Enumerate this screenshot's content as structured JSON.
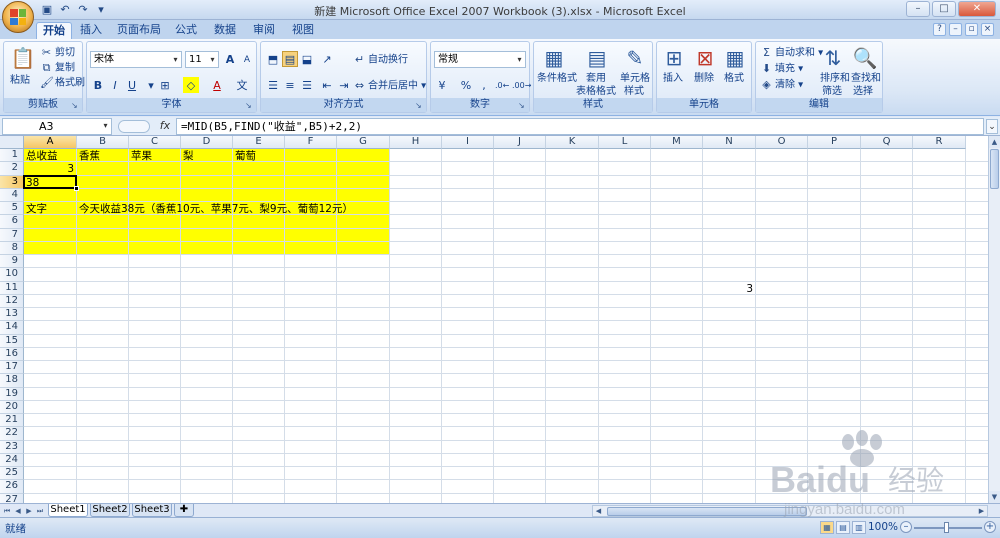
{
  "window": {
    "title": "新建 Microsoft Office Excel 2007 Workbook (3).xlsx - Microsoft Excel",
    "controls": [
      "–",
      "□",
      "✕"
    ]
  },
  "quick_access": [
    "save-icon",
    "undo-icon",
    "redo-icon",
    "customize-icon"
  ],
  "tabs": [
    {
      "label": "开始",
      "active": true
    },
    {
      "label": "插入"
    },
    {
      "label": "页面布局"
    },
    {
      "label": "公式"
    },
    {
      "label": "数据"
    },
    {
      "label": "审阅"
    },
    {
      "label": "视图"
    }
  ],
  "ribbon": {
    "clipboard": {
      "label": "剪贴板",
      "paste": "粘贴",
      "cut": "剪切",
      "copy": "复制",
      "format_painter": "格式刷"
    },
    "font": {
      "label": "字体",
      "font_name": "宋体",
      "font_size": "11",
      "bold": "B",
      "italic": "I",
      "underline": "U",
      "grow": "A",
      "shrink": "A"
    },
    "alignment": {
      "label": "对齐方式",
      "wrap": "自动换行",
      "merge": "合并后居中"
    },
    "number": {
      "label": "数字",
      "format": "常规",
      "percent": "%",
      "comma": ","
    },
    "styles": {
      "label": "样式",
      "conditional": "条件格式",
      "table_format_1": "套用",
      "table_format_2": "表格格式",
      "cell_style_1": "单元格",
      "cell_style_2": "样式"
    },
    "cells": {
      "label": "单元格",
      "insert": "插入",
      "delete": "删除",
      "format": "格式"
    },
    "editing": {
      "label": "编辑",
      "autosum": "自动求和",
      "fill": "填充",
      "clear": "清除",
      "sort_1": "排序和",
      "sort_2": "筛选",
      "find_1": "查找和",
      "find_2": "选择"
    }
  },
  "formula_bar": {
    "name_box": "A3",
    "fx": "fx",
    "formula": "=MID(B5,FIND(\"收益\",B5)+2,2)"
  },
  "columns": [
    "A",
    "B",
    "C",
    "D",
    "E",
    "F",
    "G",
    "H",
    "I",
    "J",
    "K",
    "L",
    "M",
    "N",
    "O",
    "P",
    "Q",
    "R"
  ],
  "rows": [
    "1",
    "2",
    "3",
    "4",
    "5",
    "6",
    "7",
    "8",
    "9",
    "10",
    "11",
    "12",
    "13",
    "14",
    "15",
    "16",
    "17",
    "18",
    "19",
    "20",
    "21",
    "22",
    "23",
    "24",
    "25",
    "26",
    "27"
  ],
  "cells": {
    "A1": "总收益",
    "B1": "香蕉",
    "C1": "苹果",
    "D1": "梨",
    "E1": "葡萄",
    "A2": "3",
    "A3": "38",
    "A5": "文字",
    "B5": "今天收益38元（香蕉10元、苹果7元、梨9元、葡萄12元）",
    "N11": "3"
  },
  "fill_color": "#ffff00",
  "sheets": [
    {
      "label": "Sheet1",
      "active": true
    },
    {
      "label": "Sheet2"
    },
    {
      "label": "Sheet3"
    }
  ],
  "status": {
    "ready": "就绪",
    "zoom": "100%"
  },
  "watermark": {
    "brand": "Baidu",
    "cn": "经验",
    "url": "jingyan.baidu.com"
  }
}
